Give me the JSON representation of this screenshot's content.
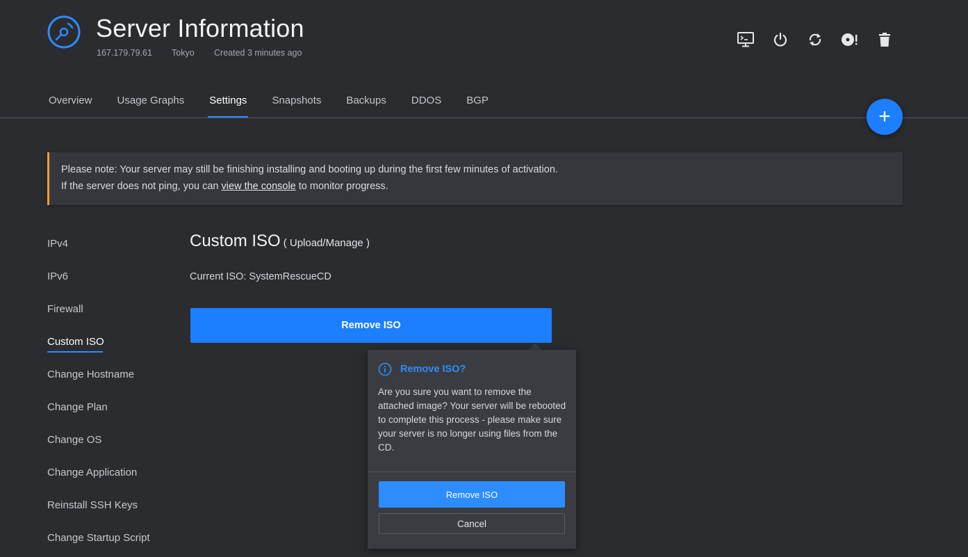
{
  "header": {
    "title": "Server Information",
    "ip": "167.179.79.61",
    "location": "Tokyo",
    "created": "Created 3 minutes ago",
    "logo_icon": "disc-icon",
    "actions": [
      {
        "name": "console-icon"
      },
      {
        "name": "power-icon"
      },
      {
        "name": "restart-icon"
      },
      {
        "name": "iso-warning-icon"
      },
      {
        "name": "trash-icon"
      }
    ]
  },
  "tabs": [
    {
      "label": "Overview",
      "active": false
    },
    {
      "label": "Usage Graphs",
      "active": false
    },
    {
      "label": "Settings",
      "active": true
    },
    {
      "label": "Snapshots",
      "active": false
    },
    {
      "label": "Backups",
      "active": false
    },
    {
      "label": "DDOS",
      "active": false
    },
    {
      "label": "BGP",
      "active": false
    }
  ],
  "fab": {
    "label": "+"
  },
  "notice": {
    "line1": "Please note: Your server may still be finishing installing and booting up during the first few minutes of activation.",
    "line2_prefix": "If the server does not ping, you can ",
    "line2_link": "view the console",
    "line2_suffix": " to monitor progress."
  },
  "side_menu": {
    "items": [
      {
        "label": "IPv4",
        "active": false
      },
      {
        "label": "IPv6",
        "active": false
      },
      {
        "label": "Firewall",
        "active": false
      },
      {
        "label": "Custom ISO",
        "active": true
      },
      {
        "label": "Change Hostname",
        "active": false
      },
      {
        "label": "Change Plan",
        "active": false
      },
      {
        "label": "Change OS",
        "active": false
      },
      {
        "label": "Change Application",
        "active": false
      },
      {
        "label": "Reinstall SSH Keys",
        "active": false
      },
      {
        "label": "Change Startup Script",
        "active": false
      }
    ]
  },
  "section": {
    "title": "Custom ISO",
    "subtitle": "( Upload/Manage )",
    "current_iso": "Current ISO: SystemRescueCD",
    "remove_button": "Remove ISO"
  },
  "popover": {
    "title": "Remove ISO?",
    "body": "Are you sure you want to remove the attached image? Your server will be rebooted to complete this process - please make sure your server is no longer using files from the CD.",
    "confirm_label": "Remove ISO",
    "cancel_label": "Cancel"
  },
  "colors": {
    "background": "#2b2c30",
    "accent": "#1b7fff",
    "notice_border": "#f0a030",
    "popover_bg": "#3b3c41"
  }
}
